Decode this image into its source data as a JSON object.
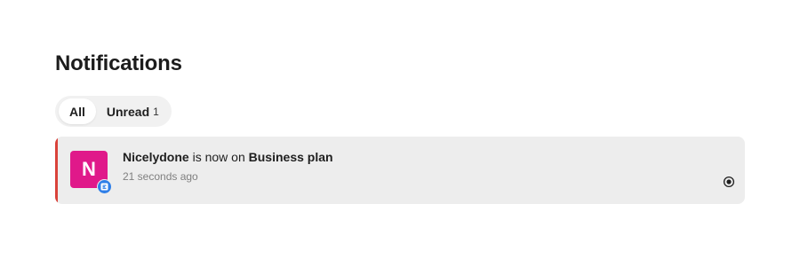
{
  "header": {
    "title": "Notifications"
  },
  "tabs": [
    {
      "label": "All",
      "active": true
    },
    {
      "label": "Unread",
      "count": "1",
      "active": false
    }
  ],
  "notifications": [
    {
      "avatar_letter": "N",
      "avatar_color": "#e0198a",
      "badge_icon": "app-badge-icon",
      "badge_color": "#2f7fe8",
      "accent_color": "#d9423a",
      "actor": "Nicelydone",
      "verb": " is now on ",
      "object": "Business plan",
      "time": "21 seconds ago",
      "unread": true,
      "action_icon": "mark-as-read-icon"
    }
  ]
}
